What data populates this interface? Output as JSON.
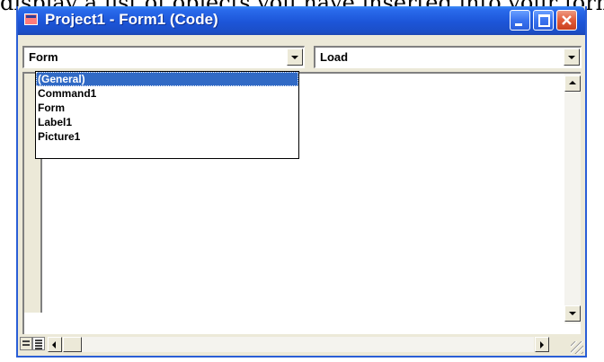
{
  "caption": {
    "text": "display a list of objects you have inserted into your form."
  },
  "window": {
    "title": "Project1 - Form1 (Code)",
    "icon": "vb-form-icon",
    "controls": [
      "minimize-icon",
      "maximize-icon",
      "close-icon"
    ]
  },
  "object_combo": {
    "value": "Form"
  },
  "procedure_combo": {
    "value": "Load"
  },
  "object_list": {
    "items": [
      {
        "label": "(General)",
        "selected": true
      },
      {
        "label": "Command1",
        "selected": false
      },
      {
        "label": "Form",
        "selected": false
      },
      {
        "label": "Label1",
        "selected": false
      },
      {
        "label": "Picture1",
        "selected": false
      }
    ]
  },
  "colors": {
    "titlebar": "#1c55d8",
    "selection": "#316ac5",
    "face": "#ece9d8",
    "close": "#e25b39"
  }
}
